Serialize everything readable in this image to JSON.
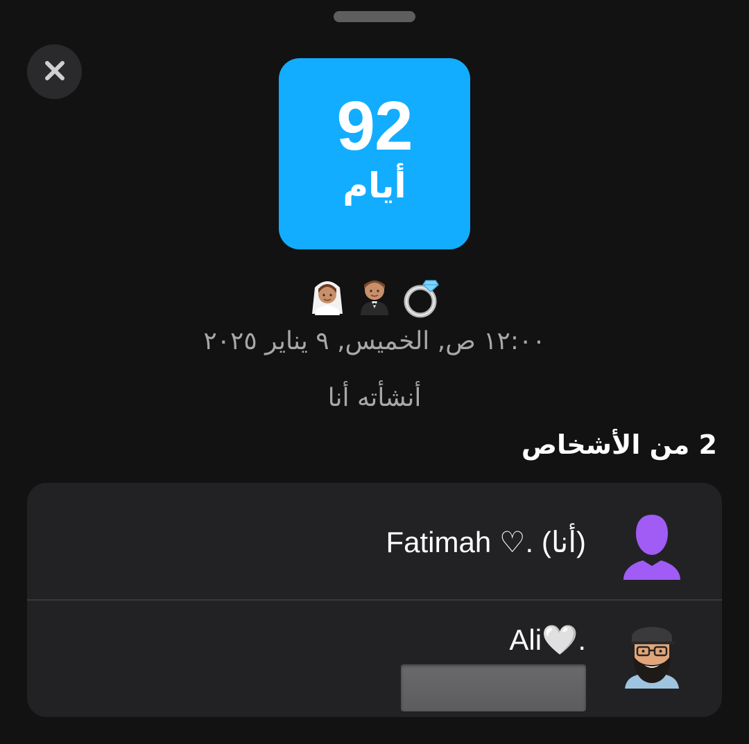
{
  "countdown": {
    "number": "92",
    "unit": "أيام",
    "tile_color": "#12adff"
  },
  "emojis": [
    "ring-emoji",
    "groom-emoji",
    "bride-emoji"
  ],
  "event": {
    "date_text": "١٢:٠٠ ص, الخميس, ٩ يناير ٢٠٢٥",
    "created_by": "أنشأته أنا"
  },
  "people": {
    "heading": "2 من الأشخاص",
    "list": [
      {
        "name": "Fatimah ♡. (أنا)",
        "avatar": "default-avatar-purple"
      },
      {
        "name": "Ali🤍.",
        "avatar": "bitmoji-avatar"
      }
    ]
  },
  "colors": {
    "background": "#121212",
    "card": "#222224",
    "secondary_text": "#a8a8aa",
    "avatar_purple": "#a05cf5"
  },
  "icons": {
    "close": "close-icon"
  }
}
